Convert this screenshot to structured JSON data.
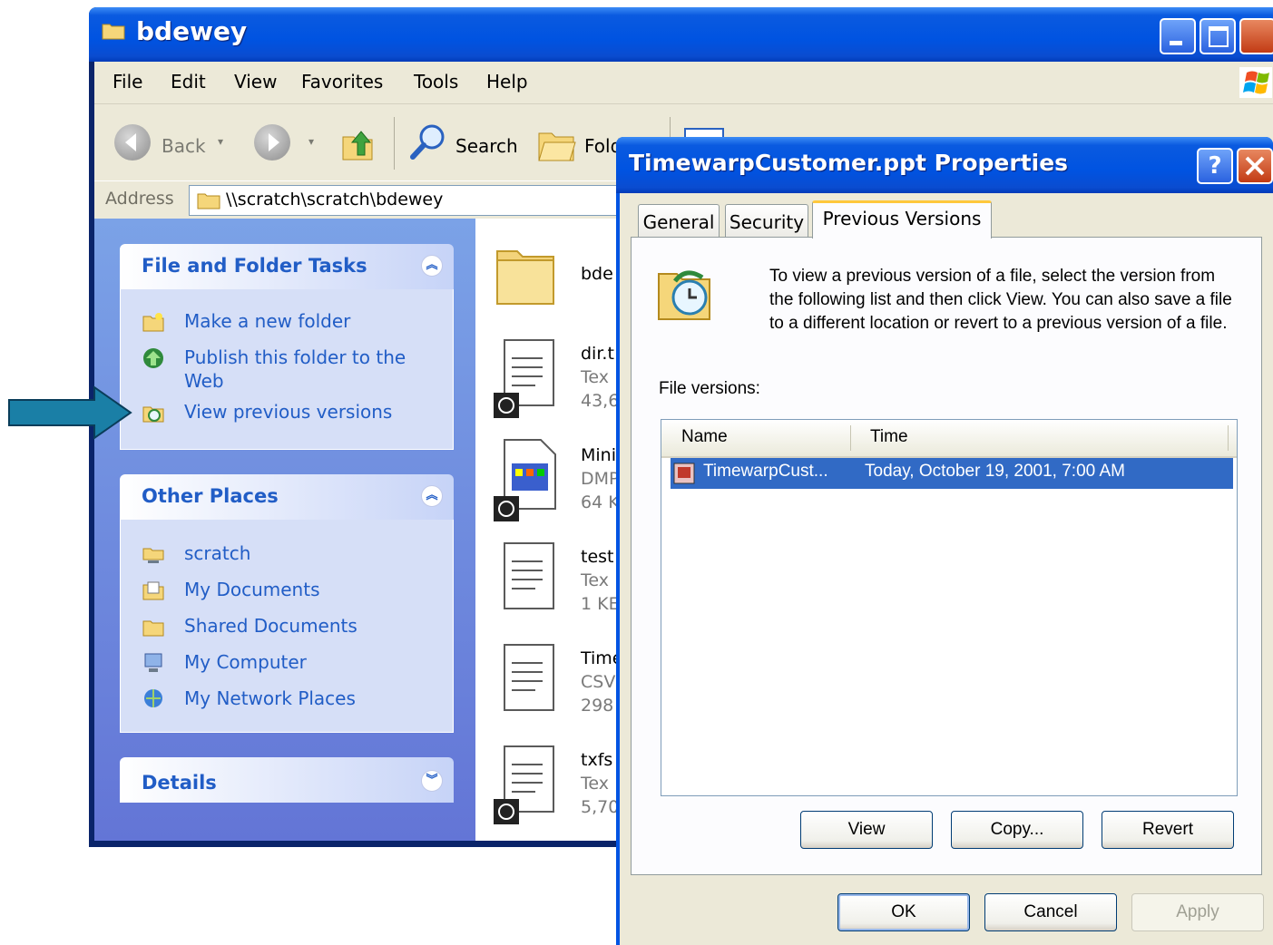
{
  "explorer": {
    "title": "bdewey",
    "menu": [
      "File",
      "Edit",
      "View",
      "Favorites",
      "Tools",
      "Help"
    ],
    "toolbar": {
      "back": "Back",
      "search": "Search",
      "folders": "Folders"
    },
    "address": {
      "label": "Address",
      "path": "\\\\scratch\\scratch\\bdewey"
    },
    "taskpane": {
      "file_folder_tasks": {
        "title": "File and Folder Tasks",
        "items": [
          "Make a new folder",
          "Publish this folder to the",
          "Web",
          "View previous versions"
        ]
      },
      "other_places": {
        "title": "Other Places",
        "items": [
          "scratch",
          "My Documents",
          "Shared Documents",
          "My Computer",
          "My Network Places"
        ]
      },
      "details": {
        "title": "Details"
      }
    },
    "files": [
      {
        "name": "bde",
        "line2": "",
        "line3": ""
      },
      {
        "name": "dir.t",
        "line2": "Tex",
        "line3": "43,6"
      },
      {
        "name": "Mini",
        "line2": "DMP",
        "line3": "64 K"
      },
      {
        "name": "test",
        "line2": "Tex",
        "line3": "1 KE"
      },
      {
        "name": "Time",
        "line2": "CSV",
        "line3": "298"
      },
      {
        "name": "txfs",
        "line2": "Tex",
        "line3": "5,70"
      }
    ]
  },
  "dialog": {
    "title": "TimewarpCustomer.ppt Properties",
    "help": "?",
    "tabs": [
      "General",
      "Security",
      "Previous Versions"
    ],
    "info": "To view a previous version of a file, select the version from the following list and then click View.  You can also save a file to a different location or revert to a previous version of a file.",
    "file_versions_label": "File versions:",
    "columns": [
      "Name",
      "Time"
    ],
    "rows": [
      {
        "name": "TimewarpCust...",
        "time": "Today, October 19, 2001, 7:00 AM"
      }
    ],
    "buttons": {
      "view": "View",
      "copy": "Copy...",
      "revert": "Revert",
      "ok": "OK",
      "cancel": "Cancel",
      "apply": "Apply"
    }
  },
  "colors": {
    "arrow": "#1a7fa6",
    "xp_blue": "#0054e3",
    "task_link": "#215dc6",
    "selection": "#316ac5"
  }
}
